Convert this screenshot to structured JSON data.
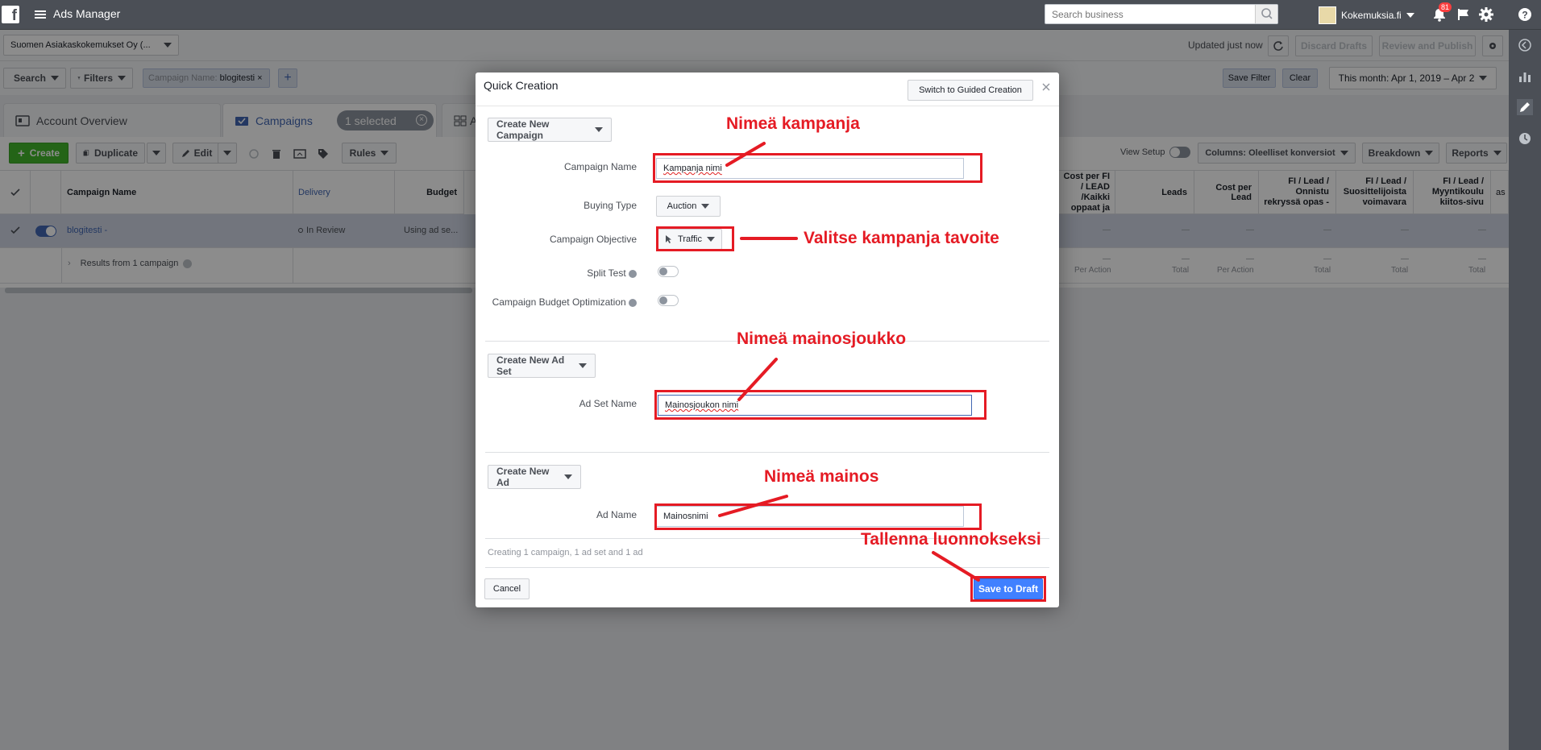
{
  "topbar": {
    "brand_logo": "f",
    "title": "Ads Manager",
    "search_placeholder": "Search business",
    "account_name": "Kokemuksia.fi",
    "notification_count": "81"
  },
  "bar2": {
    "account_selector": "Suomen Asiakaskokemukset Oy (...",
    "updated": "Updated just now",
    "discard": "Discard Drafts",
    "review": "Review and Publish"
  },
  "bar3": {
    "search": "Search",
    "filters": "Filters",
    "chip_key": "Campaign Name:",
    "chip_value": "blogitesti",
    "chip_remove": "×",
    "add_filter": "+",
    "save_filter": "Save Filter",
    "clear": "Clear",
    "date_range": "This month: Apr 1, 2019 – Apr 2"
  },
  "tabs": {
    "overview": "Account Overview",
    "campaigns": "Campaigns",
    "selected": "1 selected",
    "partial": "A"
  },
  "toolbar": {
    "create": "Create",
    "duplicate": "Duplicate",
    "edit": "Edit",
    "rules": "Rules",
    "view_setup": "View Setup",
    "columns": "Columns: Oleelliset konversiot",
    "breakdown": "Breakdown",
    "reports": "Reports"
  },
  "grid": {
    "headers": {
      "campaign_name": "Campaign Name",
      "delivery": "Delivery",
      "budget": "Budget",
      "col_cost_fi": "Cost per FI / LEAD /Kaikki oppaat ja",
      "col_leads": "Leads",
      "col_cost_lead": "Cost per Lead",
      "col_fi_onnistu": "FI / Lead / Onnistu rekryssä opas -",
      "col_fi_suos": "FI / Lead / Suosittelijoista voimavara",
      "col_fi_myynti": "FI / Lead / Myyntikoulu kiitos-sivu",
      "col_partial": "as"
    },
    "row": {
      "name": "blogitesti -",
      "delivery": "In Review",
      "budget": "Using ad se...",
      "dash": "—"
    },
    "results": {
      "label": "Results from 1 campaign",
      "per_action": "Per Action",
      "total": "Total",
      "dash": "—"
    }
  },
  "dialog": {
    "title": "Quick Creation",
    "switch": "Switch to Guided Creation",
    "campaign_section": "Create New Campaign",
    "campaign_name_label": "Campaign Name",
    "campaign_name_value": "Kampanja nimi",
    "buying_type_label": "Buying Type",
    "buying_type_value": "Auction",
    "objective_label": "Campaign Objective",
    "objective_value": "Traffic",
    "split_test_label": "Split Test",
    "cbo_label": "Campaign Budget Optimization",
    "adset_section": "Create New Ad Set",
    "adset_name_label": "Ad Set Name",
    "adset_name_value": "Mainosjoukon nimi",
    "ad_section": "Create New Ad",
    "ad_name_label": "Ad Name",
    "ad_name_value": "Mainosnimi",
    "summary": "Creating 1 campaign, 1 ad set and 1 ad",
    "cancel": "Cancel",
    "save": "Save to Draft"
  },
  "annotations": {
    "a1": "Nimeä kampanja",
    "a2": "Valitse kampanja tavoite",
    "a3": "Nimeä mainosjoukko",
    "a4": "Nimeä mainos",
    "a5": "Tallenna luonnokseksi"
  },
  "colors": {
    "topbar": "#4b4f56",
    "highlight": "#e51b24",
    "primary": "#4080ff",
    "create": "#42b72a"
  },
  "icons": [
    "facebook-logo-icon",
    "hamburger-icon",
    "search-icon",
    "bell-icon",
    "flag-icon",
    "gear-icon",
    "help-icon",
    "chart-icon",
    "pencil-icon",
    "clock-icon",
    "refresh-icon",
    "info-icon",
    "cursor-icon"
  ]
}
